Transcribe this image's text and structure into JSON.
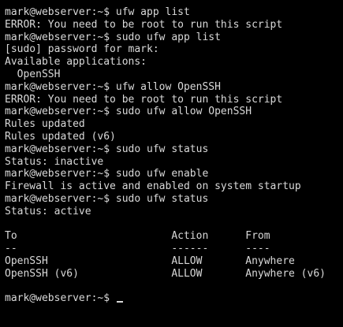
{
  "terminal": {
    "prompt": "mark@webserver:~$ ",
    "lines": [
      "mark@webserver:~$ ufw app list",
      "ERROR: You need to be root to run this script",
      "mark@webserver:~$ sudo ufw app list",
      "[sudo] password for mark:",
      "Available applications:",
      "  OpenSSH",
      "mark@webserver:~$ ufw allow OpenSSH",
      "ERROR: You need to be root to run this script",
      "mark@webserver:~$ sudo ufw allow OpenSSH",
      "Rules updated",
      "Rules updated (v6)",
      "mark@webserver:~$ sudo ufw status",
      "Status: inactive",
      "mark@webserver:~$ sudo ufw enable",
      "Firewall is active and enabled on system startup",
      "mark@webserver:~$ sudo ufw status",
      "Status: active",
      "",
      "To                         Action      From",
      "--                         ------      ----",
      "OpenSSH                    ALLOW       Anywhere",
      "OpenSSH (v6)               ALLOW       Anywhere (v6)",
      ""
    ],
    "colors": {
      "background": "#000000",
      "foreground": "#d9d9d9"
    }
  }
}
